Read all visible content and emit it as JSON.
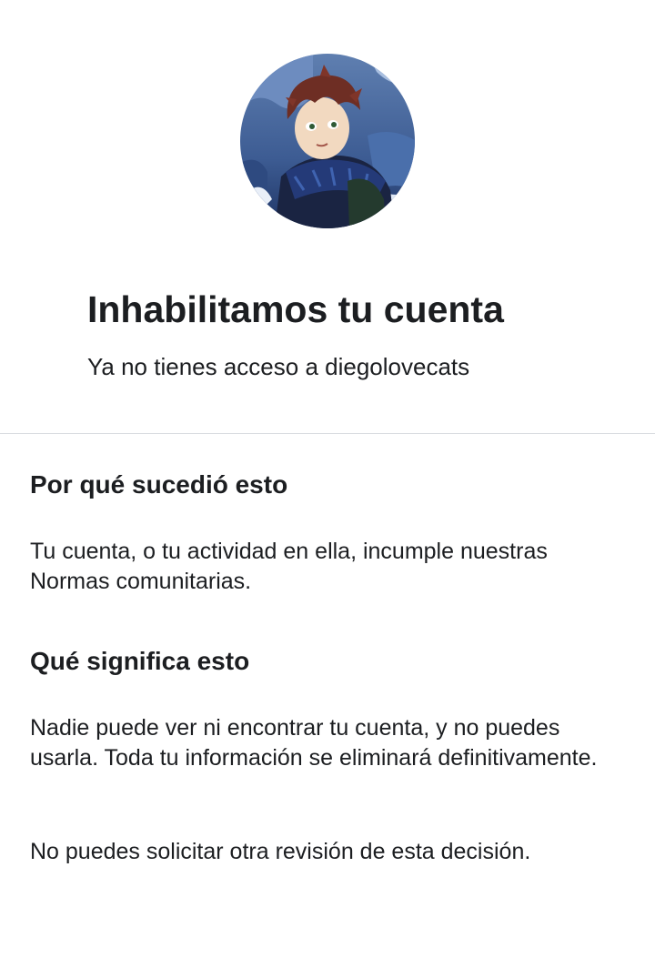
{
  "account": {
    "headline": "Inhabilitamos tu cuenta",
    "subline": "Ya no tienes acceso a diegolovecats",
    "avatar_icon": "profile-illustration"
  },
  "sections": {
    "why": {
      "title": "Por qué sucedió esto",
      "body": "Tu cuenta, o tu actividad en ella, incumple nuestras Normas comunitarias."
    },
    "meaning": {
      "title": "Qué significa esto",
      "body": "Nadie puede ver ni encontrar tu cuenta, y no puedes usarla. Toda tu información se eliminará definitivamente.",
      "note": "No puedes solicitar otra revisión de esta decisión."
    }
  },
  "colors": {
    "text": "#1c1e21",
    "divider": "#dadde1",
    "background": "#ffffff"
  }
}
